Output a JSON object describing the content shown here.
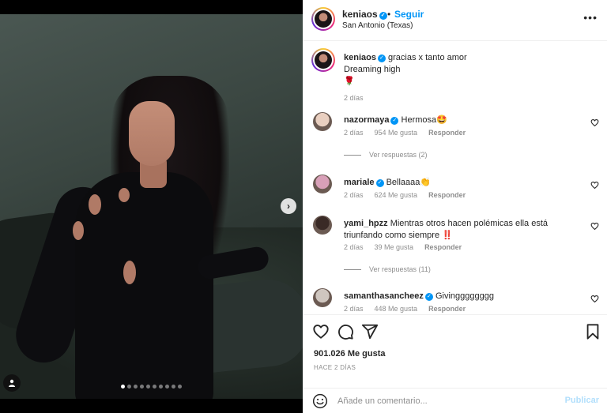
{
  "post": {
    "username": "keniaos",
    "follow_label": "Seguir",
    "separator": "•",
    "location": "San Antonio (Texas)",
    "more_icon": "more-horizontal-icon",
    "carousel": {
      "slide_count": 10,
      "active_index": 0,
      "next_icon": "chevron-right-icon"
    }
  },
  "caption": {
    "username": "keniaos",
    "text": "gracias x tanto amor",
    "line2": "Dreaming high",
    "emoji": "🌹",
    "time": "2 días"
  },
  "comments": [
    {
      "username": "nazormaya",
      "verified": true,
      "text": "Hermosa🤩",
      "time": "2 días",
      "likes": "954 Me gusta",
      "reply": "Responder",
      "replies": "Ver respuestas (2)",
      "avatar_color": "#e9cfc0"
    },
    {
      "username": "mariale",
      "verified": true,
      "text": "Bellaaaa👏",
      "time": "2 días",
      "likes": "624 Me gusta",
      "reply": "Responder",
      "replies": "",
      "avatar_color": "#d8a0b8"
    },
    {
      "username": "yami_hpzz",
      "verified": false,
      "text": "Mientras otros hacen polémicas ella está triunfando como siempre ‼️",
      "time": "2 días",
      "likes": "39 Me gusta",
      "reply": "Responder",
      "replies": "Ver respuestas (11)",
      "avatar_color": "#3a2a26"
    },
    {
      "username": "samanthasancheez",
      "verified": true,
      "text": "Givingggggggg",
      "time": "2 días",
      "likes": "448 Me gusta",
      "reply": "Responder",
      "replies": "",
      "avatar_color": "#cfc6bf"
    }
  ],
  "actions": {
    "like_icon": "heart-icon",
    "comment_icon": "comment-icon",
    "share_icon": "send-icon",
    "save_icon": "bookmark-icon",
    "likes": "901.026 Me gusta",
    "ago": "HACE 2 DÍAS"
  },
  "add_comment": {
    "emoji_icon": "emoji-icon",
    "placeholder": "Añade un comentario...",
    "publish_label": "Publicar"
  },
  "colors": {
    "accent": "#0095f6",
    "publish_disabled": "#b2dffc",
    "muted": "#8e8e8e"
  }
}
